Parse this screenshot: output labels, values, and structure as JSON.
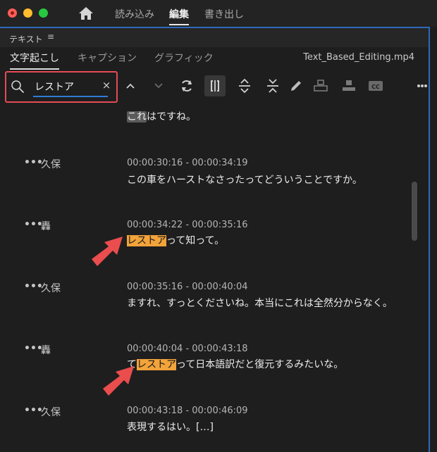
{
  "topnav": {
    "import": "読み込み",
    "edit": "編集",
    "export": "書き出し"
  },
  "panel": {
    "title": "テキスト",
    "menu_icon": "hamburger-icon",
    "tabs": [
      "文字起こし",
      "キャプション",
      "グラフィック"
    ],
    "filename": "Text_Based_Editing.mp4"
  },
  "search": {
    "value": "レストア",
    "clear": "×"
  },
  "toolbar": {
    "icons": [
      "chevron-up-icon",
      "chevron-down-icon",
      "refresh-icon",
      "split-icon",
      "expand-icon",
      "collapse-icon",
      "pencil-icon",
      "speaker-block-icon",
      "insert-block-icon",
      "cc-icon"
    ]
  },
  "transcript": {
    "partial": {
      "pre": "これ",
      "text": "はですね。"
    },
    "entries": [
      {
        "speaker": "久保",
        "timecode": "00:00:30:16 - 00:00:34:19",
        "text": "この車をハーストなさったってどういうことですか。"
      },
      {
        "speaker": "轟",
        "timecode": "00:00:34:22 - 00:00:35:16",
        "highlight": "レストア",
        "text": "って知って。"
      },
      {
        "speaker": "久保",
        "timecode": "00:00:35:16 - 00:00:40:04",
        "text": "ますれ、すっとくださいね。本当にこれは全然分からなく。"
      },
      {
        "speaker": "轟",
        "timecode": "00:00:40:04 - 00:00:43:18",
        "pre": "て",
        "highlight": "レストア",
        "text": "って日本語訳だと復元するみたいな。"
      },
      {
        "speaker": "久保",
        "timecode": "00:00:43:18 - 00:00:46:09",
        "text": "表現するはい。[…]"
      }
    ]
  },
  "colors": {
    "accent": "#2f68b8",
    "search_highlight": "#f2a33a",
    "annotation": "#e54b55"
  }
}
